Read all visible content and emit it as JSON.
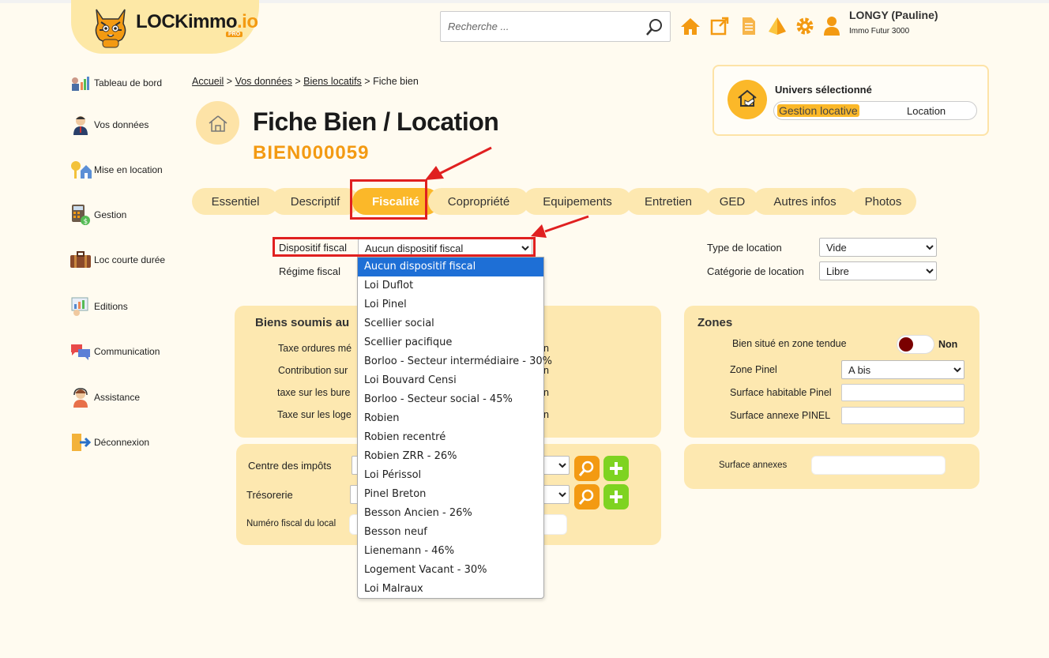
{
  "header": {
    "logo_text": "LOCKimmo",
    "logo_suffix": ".io",
    "logo_badge": "PRO",
    "search_placeholder": "Recherche ...",
    "icons": [
      "home-icon",
      "external-link-icon",
      "document-icon",
      "pyramid-icon",
      "gear-icon",
      "user-icon"
    ],
    "user_name": "LONGY (Pauline)",
    "user_org": "Immo Futur 3000"
  },
  "sidebar": {
    "items": [
      {
        "label": "Tableau de bord",
        "icon": "dashboard-icon"
      },
      {
        "label": "Vos données",
        "icon": "person-icon"
      },
      {
        "label": "Mise en location",
        "icon": "keys-house-icon"
      },
      {
        "label": "Gestion",
        "icon": "calculator-icon"
      },
      {
        "label": "Loc courte durée",
        "icon": "suitcase-icon"
      },
      {
        "label": "Editions",
        "icon": "report-icon"
      },
      {
        "label": "Communication",
        "icon": "chat-bubbles-icon"
      },
      {
        "label": "Assistance",
        "icon": "support-agent-icon"
      },
      {
        "label": "Déconnexion",
        "icon": "logout-icon"
      }
    ]
  },
  "breadcrumb": {
    "items": [
      "Accueil",
      "Vos données",
      "Biens locatifs"
    ],
    "separator": ">",
    "current": "Fiche bien"
  },
  "page": {
    "title": "Fiche Bien / Location",
    "reference": "BIEN000059"
  },
  "universe": {
    "label": "Univers sélectionné",
    "option_selected": "Gestion locative",
    "option_other": "Location"
  },
  "tabs": [
    {
      "label": "Essentiel",
      "active": false
    },
    {
      "label": "Descriptif",
      "active": false
    },
    {
      "label": "Fiscalité",
      "active": true
    },
    {
      "label": "Copropriété",
      "active": false
    },
    {
      "label": "Equipements",
      "active": false
    },
    {
      "label": "Entretien",
      "active": false
    },
    {
      "label": "GED",
      "active": false
    },
    {
      "label": "Autres infos",
      "active": false
    },
    {
      "label": "Photos",
      "active": false
    }
  ],
  "fiscal": {
    "dispositif_label": "Dispositif fiscal",
    "dispositif_value": "Aucun dispositif fiscal",
    "regime_label": "Régime fiscal",
    "type_location_label": "Type de location",
    "type_location_value": "Vide",
    "categorie_label": "Catégorie de location",
    "categorie_value": "Libre"
  },
  "taxes_panel": {
    "title": "Biens soumis au",
    "rows": [
      "Taxe ordures mé",
      "Contribution sur",
      "taxe sur les bure",
      "Taxe sur les loge"
    ],
    "row_values": [
      "n",
      "n",
      "n",
      "n"
    ]
  },
  "impots_panel": {
    "centre_label": "Centre des impôts",
    "tresorerie_label": "Trésorerie",
    "numero_label": "Numéro fiscal du local"
  },
  "zones_panel": {
    "title": "Zones",
    "zone_tendue_label": "Bien situé en zone tendue",
    "zone_tendue_value": "Non",
    "zone_pinel_label": "Zone Pinel",
    "zone_pinel_value": "A bis",
    "surface_habitable_label": "Surface habitable Pinel",
    "surface_annexe_label": "Surface annexe PINEL"
  },
  "annexes_panel": {
    "label": "Surface annexes"
  },
  "dropdown_options": [
    "Aucun dispositif fiscal",
    "Loi Duflot",
    "Loi Pinel",
    "Scellier social",
    "Scellier pacifique",
    "Borloo - Secteur intermédiaire - 30%",
    "Loi Bouvard Censi",
    "Borloo - Secteur social - 45%",
    "Robien",
    "Robien recentré",
    "Robien ZRR - 26%",
    "Loi Périssol",
    "Pinel Breton",
    "Besson Ancien - 26%",
    "Besson neuf",
    "Lienemann - 46%",
    "Logement Vacant - 30%",
    "Loi Malraux"
  ],
  "dropdown_selected_index": 0,
  "colors": {
    "accent": "#fbb829",
    "accent_text": "#f39a12",
    "panel": "#fde8b0",
    "background": "#fffbf0",
    "highlight": "#e02020",
    "selected_option": "#1e6fd6",
    "add_button": "#7ed321"
  }
}
